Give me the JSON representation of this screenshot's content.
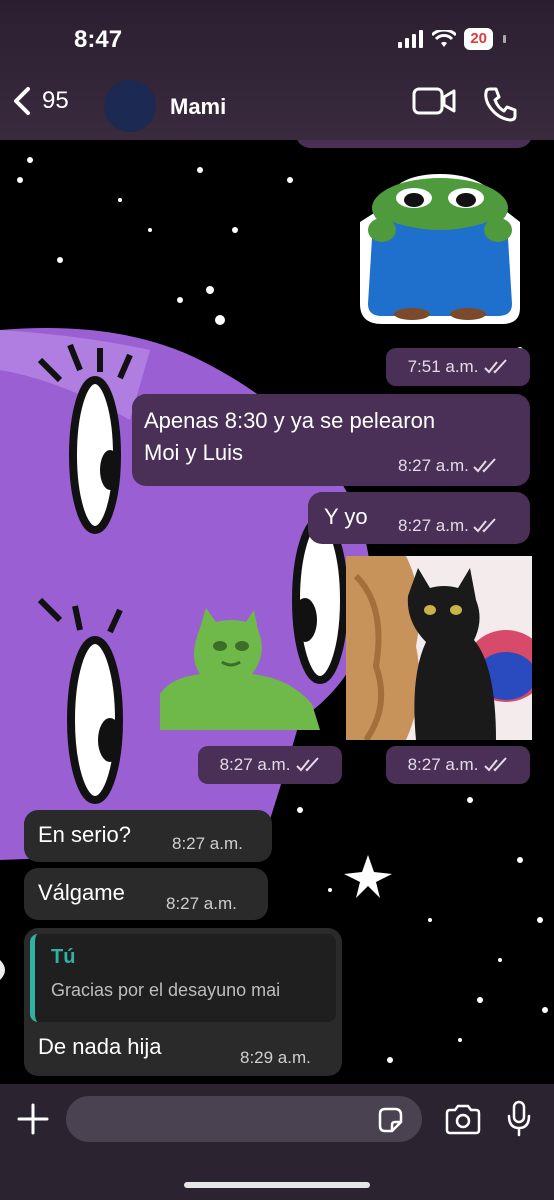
{
  "status": {
    "time": "8:47",
    "battery": "20"
  },
  "header": {
    "back_count": "95",
    "contact": "Mami"
  },
  "messages": {
    "sticker1_time": "7:51 a.m.",
    "m1_line1": "Apenas 8:30 y ya se pelearon",
    "m1_line2": "Moi y Luis",
    "m1_time": "8:27 a.m.",
    "m2_text": "Y yo",
    "m2_time": "8:27 a.m.",
    "sticker2_time": "8:27 a.m.",
    "sticker3_time": "8:27 a.m.",
    "m3_text": "En serio?",
    "m3_time": "8:27 a.m.",
    "m4_text": "Válgame",
    "m4_time": "8:27 a.m.",
    "m5_quote_author": "Tú",
    "m5_quote_text": "Gracias por el desayuno mai",
    "m5_text": "De nada hija",
    "m5_time": "8:29 a.m."
  },
  "composer": {
    "placeholder": ""
  },
  "colors": {
    "outgoing": "#4a2f56",
    "incoming": "#2a2a2a",
    "quote_accent": "#2fb3a0",
    "battery_text": "#e03a3a"
  },
  "icons": [
    "back-chevron-icon",
    "video-call-icon",
    "phone-icon",
    "double-check-icon",
    "plus-icon",
    "sticker-icon",
    "camera-icon",
    "mic-icon"
  ]
}
